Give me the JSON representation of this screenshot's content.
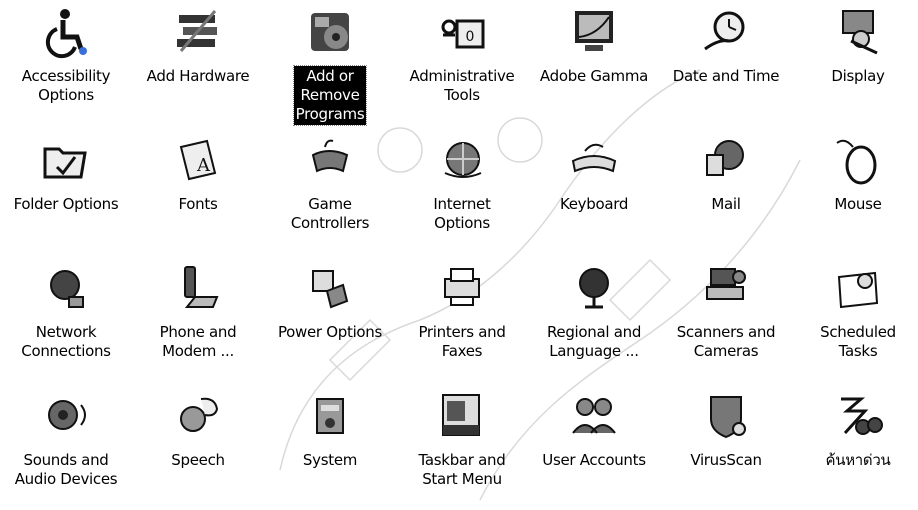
{
  "items": [
    {
      "label": "Accessibility\nOptions",
      "icon": "accessibility-icon"
    },
    {
      "label": "Add Hardware",
      "icon": "add-hardware-icon"
    },
    {
      "label": "Add or\nRemove\nPrograms",
      "icon": "add-remove-programs-icon",
      "selected": true
    },
    {
      "label": "Administrative\nTools",
      "icon": "administrative-tools-icon"
    },
    {
      "label": "Adobe Gamma",
      "icon": "adobe-gamma-icon"
    },
    {
      "label": "Date and Time",
      "icon": "date-time-icon"
    },
    {
      "label": "Display",
      "icon": "display-icon"
    },
    {
      "label": "Folder Options",
      "icon": "folder-options-icon"
    },
    {
      "label": "Fonts",
      "icon": "fonts-icon"
    },
    {
      "label": "Game\nControllers",
      "icon": "game-controllers-icon"
    },
    {
      "label": "Internet\nOptions",
      "icon": "internet-options-icon"
    },
    {
      "label": "Keyboard",
      "icon": "keyboard-icon"
    },
    {
      "label": "Mail",
      "icon": "mail-icon"
    },
    {
      "label": "Mouse",
      "icon": "mouse-icon"
    },
    {
      "label": "Network\nConnections",
      "icon": "network-connections-icon"
    },
    {
      "label": "Phone and\nModem ...",
      "icon": "phone-modem-icon"
    },
    {
      "label": "Power Options",
      "icon": "power-options-icon"
    },
    {
      "label": "Printers and\nFaxes",
      "icon": "printers-faxes-icon"
    },
    {
      "label": "Regional and\nLanguage ...",
      "icon": "regional-language-icon"
    },
    {
      "label": "Scanners and\nCameras",
      "icon": "scanners-cameras-icon"
    },
    {
      "label": "Scheduled\nTasks",
      "icon": "scheduled-tasks-icon"
    },
    {
      "label": "Sounds and\nAudio Devices",
      "icon": "sounds-audio-icon"
    },
    {
      "label": "Speech",
      "icon": "speech-icon"
    },
    {
      "label": "System",
      "icon": "system-icon"
    },
    {
      "label": "Taskbar and\nStart Menu",
      "icon": "taskbar-start-menu-icon"
    },
    {
      "label": "User Accounts",
      "icon": "user-accounts-icon"
    },
    {
      "label": "VirusScan",
      "icon": "virusscan-icon"
    },
    {
      "label": "ค้นหาด่วน",
      "icon": "search-binoculars-icon"
    }
  ]
}
